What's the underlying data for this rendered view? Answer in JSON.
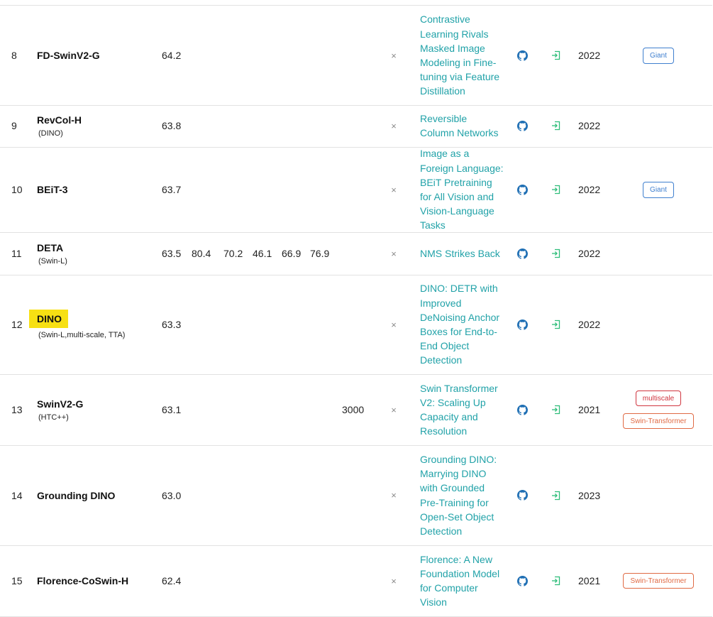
{
  "rows": [
    {
      "rank": "8",
      "model": "FD-SwinV2-G",
      "sub": "",
      "highlight": false,
      "metrics": [
        "64.2",
        "",
        "",
        "",
        "",
        "",
        ""
      ],
      "x": "×",
      "paper": "Contrastive Learning Rivals Masked Image Modeling in Fine-tuning via Feature Distillation",
      "year": "2022",
      "tags": [
        {
          "label": "Giant",
          "style": "giant"
        }
      ]
    },
    {
      "rank": "9",
      "model": "RevCol-H",
      "sub": "(DINO)",
      "highlight": false,
      "metrics": [
        "63.8",
        "",
        "",
        "",
        "",
        "",
        ""
      ],
      "x": "×",
      "paper": "Reversible Column Networks",
      "year": "2022",
      "tags": []
    },
    {
      "rank": "10",
      "model": "BEiT-3",
      "sub": "",
      "highlight": false,
      "metrics": [
        "63.7",
        "",
        "",
        "",
        "",
        "",
        ""
      ],
      "x": "×",
      "paper": "Image as a Foreign Language: BEiT Pretraining for All Vision and Vision-Language Tasks",
      "year": "2022",
      "tags": [
        {
          "label": "Giant",
          "style": "giant"
        }
      ]
    },
    {
      "rank": "11",
      "model": "DETA",
      "sub": "(Swin-L)",
      "highlight": false,
      "metrics": [
        "63.5",
        "80.4",
        "70.2",
        "46.1",
        "66.9",
        "76.9",
        ""
      ],
      "x": "×",
      "paper": "NMS Strikes Back",
      "year": "2022",
      "tags": []
    },
    {
      "rank": "12",
      "model": "DINO",
      "sub": "(Swin-L,multi-scale, TTA)",
      "highlight": true,
      "metrics": [
        "63.3",
        "",
        "",
        "",
        "",
        "",
        ""
      ],
      "x": "×",
      "paper": "DINO: DETR with Improved DeNoising Anchor Boxes for End-to-End Object Detection",
      "year": "2022",
      "tags": []
    },
    {
      "rank": "13",
      "model": "SwinV2-G",
      "sub": "(HTC++)",
      "highlight": false,
      "metrics": [
        "63.1",
        "",
        "",
        "",
        "",
        "",
        "3000"
      ],
      "x": "×",
      "paper": "Swin Transformer V2: Scaling Up Capacity and Resolution",
      "year": "2021",
      "tags": [
        {
          "label": "multiscale",
          "style": "multiscale"
        },
        {
          "label": "Swin-Transformer",
          "style": "swin"
        }
      ]
    },
    {
      "rank": "14",
      "model": "Grounding DINO",
      "sub": "",
      "highlight": false,
      "metrics": [
        "63.0",
        "",
        "",
        "",
        "",
        "",
        ""
      ],
      "x": "×",
      "paper": "Grounding DINO: Marrying DINO with Grounded Pre-Training for Open-Set Object Detection",
      "year": "2023",
      "tags": []
    },
    {
      "rank": "15",
      "model": "Florence-CoSwin-H",
      "sub": "",
      "highlight": false,
      "metrics": [
        "62.4",
        "",
        "",
        "",
        "",
        "",
        ""
      ],
      "x": "×",
      "paper": "Florence: A New Foundation Model for Computer Vision",
      "year": "2021",
      "tags": [
        {
          "label": "Swin-Transformer",
          "style": "swin"
        }
      ]
    }
  ],
  "icons": {
    "code": "github-icon",
    "results": "external-entry-icon"
  },
  "colors": {
    "link": "#21a2a8",
    "highlight": "#f7e013",
    "giant": "#3f7fcf",
    "multiscale": "#d0353f",
    "swin": "#e06a44"
  }
}
